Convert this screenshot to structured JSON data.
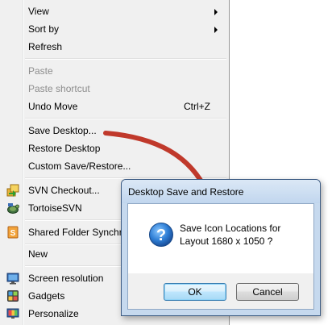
{
  "menu": {
    "items": [
      {
        "id": "view",
        "label": "View",
        "submenu": true
      },
      {
        "id": "sort-by",
        "label": "Sort by",
        "submenu": true
      },
      {
        "id": "refresh",
        "label": "Refresh"
      },
      {
        "id": "paste",
        "label": "Paste",
        "disabled": true
      },
      {
        "id": "paste-shortcut",
        "label": "Paste shortcut",
        "disabled": true
      },
      {
        "id": "undo-move",
        "label": "Undo Move",
        "shortcut": "Ctrl+Z"
      },
      {
        "id": "save-desktop",
        "label": "Save Desktop..."
      },
      {
        "id": "restore-desktop",
        "label": "Restore Desktop"
      },
      {
        "id": "custom-save-restore",
        "label": "Custom Save/Restore..."
      },
      {
        "id": "svn-checkout",
        "label": "SVN Checkout...",
        "icon": "svn-checkout-icon"
      },
      {
        "id": "tortoisesvn",
        "label": "TortoiseSVN",
        "icon": "tortoisesvn-icon"
      },
      {
        "id": "shared-folder-sync",
        "label": "Shared Folder Synchro",
        "icon": "shared-folder-icon"
      },
      {
        "id": "new",
        "label": "New",
        "submenu": true
      },
      {
        "id": "screen-resolution",
        "label": "Screen resolution",
        "icon": "screen-resolution-icon"
      },
      {
        "id": "gadgets",
        "label": "Gadgets",
        "icon": "gadgets-icon"
      },
      {
        "id": "personalize",
        "label": "Personalize",
        "icon": "personalize-icon"
      }
    ]
  },
  "annotation": {
    "arrow_color": "#c0392b"
  },
  "dialog": {
    "title": "Desktop Save and Restore",
    "message_line1": "Save Icon Locations for",
    "message_line2": "Layout 1680 x 1050 ?",
    "icon": "question-icon",
    "ok_label": "OK",
    "cancel_label": "Cancel"
  }
}
